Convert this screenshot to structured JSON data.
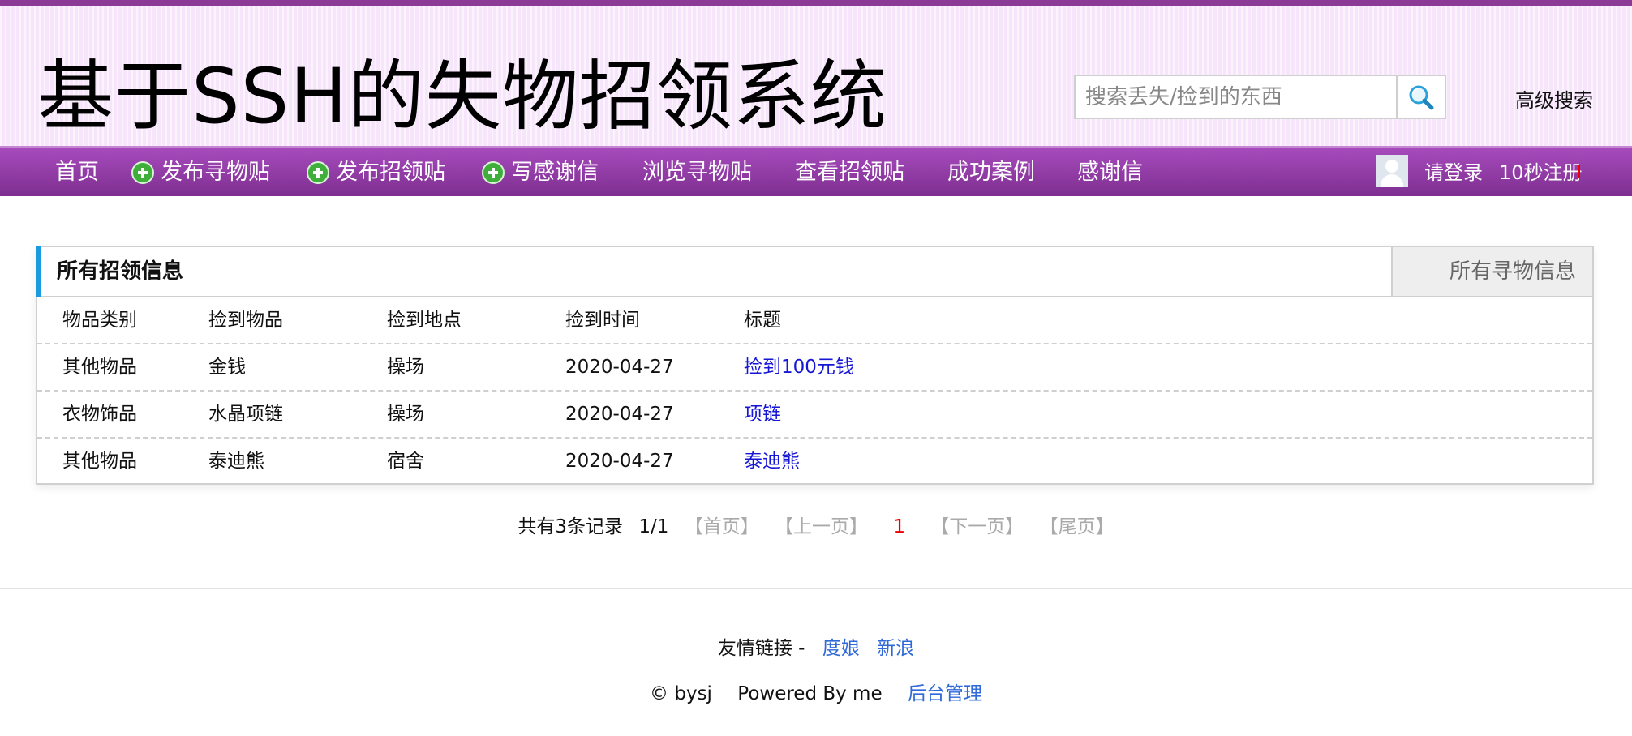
{
  "header": {
    "site_title": "基于SSH的失物招领系统",
    "search_placeholder": "搜索丢失/捡到的东西",
    "advanced_search": "高级搜索"
  },
  "nav": {
    "home": "首页",
    "post_lost": "发布寻物贴",
    "post_found": "发布招领贴",
    "write_thanks": "写感谢信",
    "browse_lost": "浏览寻物贴",
    "view_found": "查看招领贴",
    "success_cases": "成功案例",
    "thanks_letters": "感谢信",
    "login": "请登录",
    "register": "10秒注册"
  },
  "panel": {
    "title": "所有招领信息",
    "other_tab": "所有寻物信息",
    "columns": [
      "物品类别",
      "捡到物品",
      "捡到地点",
      "捡到时间",
      "标题"
    ],
    "rows": [
      [
        "其他物品",
        "金钱",
        "操场",
        "2020-04-27",
        "捡到100元钱"
      ],
      [
        "衣物饰品",
        "水晶项链",
        "操场",
        "2020-04-27",
        "项链"
      ],
      [
        "其他物品",
        "泰迪熊",
        "宿舍",
        "2020-04-27",
        "泰迪熊"
      ]
    ]
  },
  "pager": {
    "total": "共有3条记录",
    "page": "1/1",
    "first": "【首页】",
    "prev": "【上一页】",
    "current": "1",
    "next": "【下一页】",
    "last": "【尾页】"
  },
  "footer": {
    "friend_label": "友情链接 -",
    "link1": "度娘",
    "link2": "新浪",
    "copyright": "© bysj",
    "powered": "Powered By me",
    "admin": "后台管理"
  },
  "colors": {
    "nav_purple": "#8b3b95",
    "accent_blue": "#1a9be0",
    "link_blue": "#1616d6"
  }
}
